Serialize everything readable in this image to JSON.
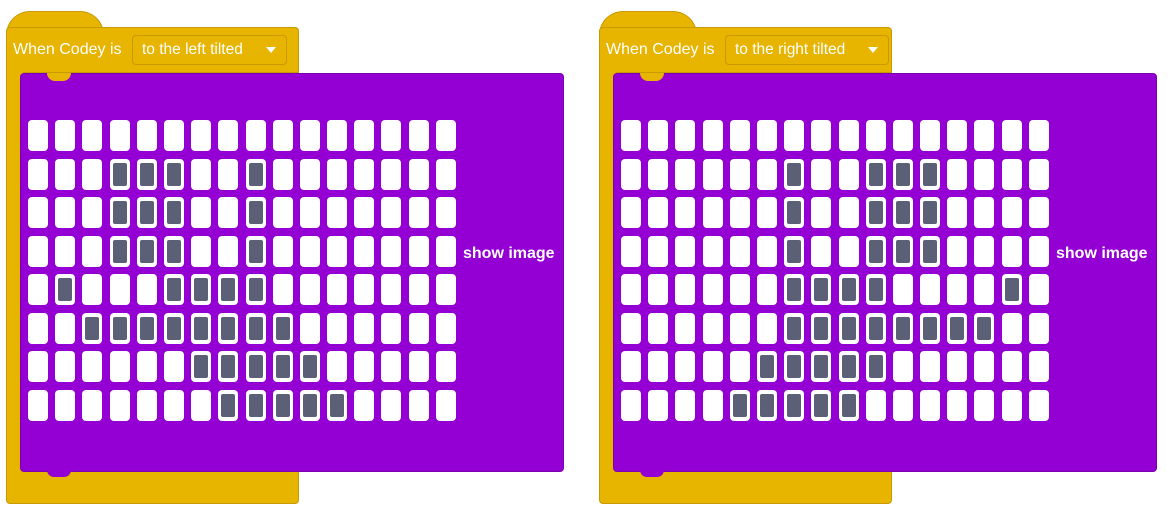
{
  "blocks": [
    {
      "event_label": "When Codey is",
      "dropdown_value": "to the left tilted",
      "action_label": "show image",
      "matrix": [
        [
          0,
          0,
          0,
          0,
          0,
          0,
          0,
          0,
          0,
          0,
          0,
          0,
          0,
          0,
          0,
          0
        ],
        [
          0,
          0,
          0,
          1,
          1,
          1,
          0,
          0,
          1,
          0,
          0,
          0,
          0,
          0,
          0,
          0
        ],
        [
          0,
          0,
          0,
          1,
          1,
          1,
          0,
          0,
          1,
          0,
          0,
          0,
          0,
          0,
          0,
          0
        ],
        [
          0,
          0,
          0,
          1,
          1,
          1,
          0,
          0,
          1,
          0,
          0,
          0,
          0,
          0,
          0,
          0
        ],
        [
          0,
          1,
          0,
          0,
          0,
          1,
          1,
          1,
          1,
          0,
          0,
          0,
          0,
          0,
          0,
          0
        ],
        [
          0,
          0,
          1,
          1,
          1,
          1,
          1,
          1,
          1,
          1,
          0,
          0,
          0,
          0,
          0,
          0
        ],
        [
          0,
          0,
          0,
          0,
          0,
          0,
          1,
          1,
          1,
          1,
          1,
          0,
          0,
          0,
          0,
          0
        ],
        [
          0,
          0,
          0,
          0,
          0,
          0,
          0,
          1,
          1,
          1,
          1,
          1,
          0,
          0,
          0,
          0
        ]
      ]
    },
    {
      "event_label": "When Codey is",
      "dropdown_value": "to the right tilted",
      "action_label": "show image",
      "matrix": [
        [
          0,
          0,
          0,
          0,
          0,
          0,
          0,
          0,
          0,
          0,
          0,
          0,
          0,
          0,
          0,
          0
        ],
        [
          0,
          0,
          0,
          0,
          0,
          0,
          1,
          0,
          0,
          1,
          1,
          1,
          0,
          0,
          0,
          0
        ],
        [
          0,
          0,
          0,
          0,
          0,
          0,
          1,
          0,
          0,
          1,
          1,
          1,
          0,
          0,
          0,
          0
        ],
        [
          0,
          0,
          0,
          0,
          0,
          0,
          1,
          0,
          0,
          1,
          1,
          1,
          0,
          0,
          0,
          0
        ],
        [
          0,
          0,
          0,
          0,
          0,
          0,
          1,
          1,
          1,
          1,
          0,
          0,
          0,
          0,
          1,
          0
        ],
        [
          0,
          0,
          0,
          0,
          0,
          0,
          1,
          1,
          1,
          1,
          1,
          1,
          1,
          1,
          0,
          0
        ],
        [
          0,
          0,
          0,
          0,
          0,
          1,
          1,
          1,
          1,
          1,
          0,
          0,
          0,
          0,
          0,
          0
        ],
        [
          0,
          0,
          0,
          0,
          1,
          1,
          1,
          1,
          1,
          0,
          0,
          0,
          0,
          0,
          0,
          0
        ]
      ]
    }
  ]
}
